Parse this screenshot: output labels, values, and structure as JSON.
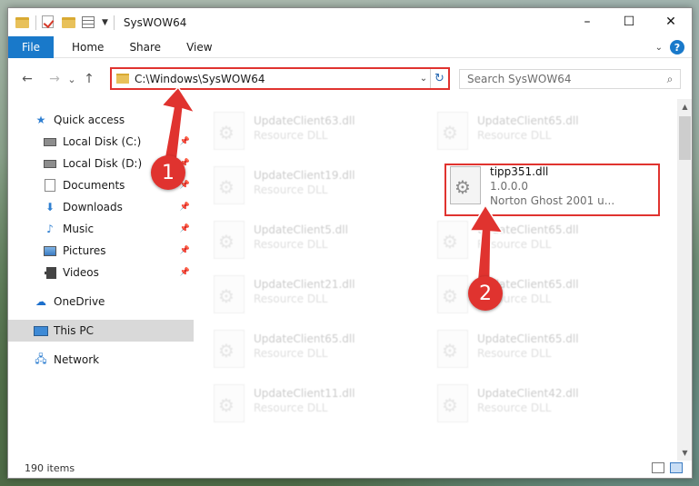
{
  "window": {
    "title": "SysWOW64",
    "controls": {
      "minimize": "–",
      "maximize": "☐",
      "close": "✕"
    }
  },
  "ribbon": {
    "tabs": [
      "File",
      "Home",
      "Share",
      "View"
    ],
    "expand_icon": "chevron-down-icon",
    "help_icon": "?"
  },
  "nav": {
    "back": "←",
    "forward": "→",
    "recent": "⌄",
    "up": "↑",
    "address_path": "C:\\Windows\\SysWOW64",
    "search_placeholder": "Search SysWOW64"
  },
  "sidebar": {
    "items": [
      {
        "label": "Quick access",
        "icon": "star-icon",
        "pinned": false
      },
      {
        "label": "Local Disk (C:)",
        "icon": "drive-icon",
        "pinned": true
      },
      {
        "label": "Local Disk (D:)",
        "icon": "drive-icon",
        "pinned": true
      },
      {
        "label": "Documents",
        "icon": "documents-icon",
        "pinned": true
      },
      {
        "label": "Downloads",
        "icon": "download-icon",
        "pinned": true
      },
      {
        "label": "Music",
        "icon": "music-icon",
        "pinned": true
      },
      {
        "label": "Pictures",
        "icon": "pictures-icon",
        "pinned": true
      },
      {
        "label": "Videos",
        "icon": "videos-icon",
        "pinned": true
      },
      {
        "label": "OneDrive",
        "icon": "cloud-icon",
        "pinned": false
      },
      {
        "label": "This PC",
        "icon": "computer-icon",
        "pinned": false,
        "selected": true
      },
      {
        "label": "Network",
        "icon": "network-icon",
        "pinned": false
      }
    ]
  },
  "files": {
    "left_column": [
      {
        "name": "UpdateClient63.dll",
        "type": "Resource DLL"
      },
      {
        "name": "UpdateClient19.dll",
        "type": "Resource DLL"
      },
      {
        "name": "UpdateClient5.dll",
        "type": "Resource DLL"
      },
      {
        "name": "UpdateClient21.dll",
        "type": "Resource DLL"
      },
      {
        "name": "UpdateClient65.dll",
        "type": "Resource DLL"
      },
      {
        "name": "UpdateClient11.dll",
        "type": "Resource DLL"
      }
    ],
    "right_column": [
      {
        "name": "UpdateClient65.dll",
        "type": "Resource DLL"
      },
      {
        "name": "UpdateClient65.dll",
        "type": "Resource DLL"
      },
      {
        "name": "UpdateClient65.dll",
        "type": "Resource DLL"
      },
      {
        "name": "UpdateClient65.dll",
        "type": "Resource DLL"
      },
      {
        "name": "UpdateClient42.dll",
        "type": "Resource DLL"
      }
    ],
    "highlighted": {
      "name": "tipp351.dll",
      "version": "1.0.0.0",
      "description": "Norton Ghost 2001 u..."
    }
  },
  "status": {
    "item_count": "190 items"
  },
  "annotations": {
    "step1": "1",
    "step2": "2",
    "color": "#e0332f"
  }
}
